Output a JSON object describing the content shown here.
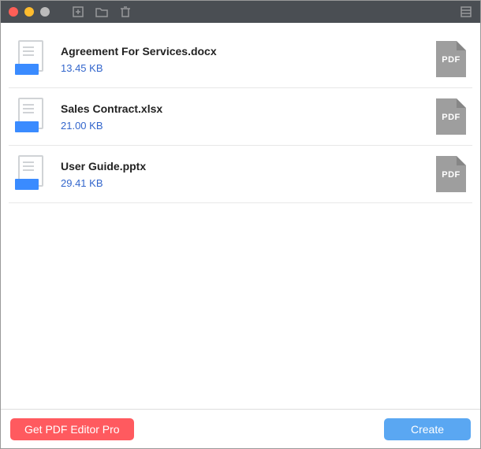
{
  "titlebar": {
    "icons": {
      "add": "add-file-icon",
      "folder": "folder-icon",
      "trash": "trash-icon",
      "list": "list-icon"
    }
  },
  "files": [
    {
      "name": "Agreement For Services.docx",
      "size": "13.45 KB",
      "target_label": "PDF"
    },
    {
      "name": "Sales Contract.xlsx",
      "size": "21.00 KB",
      "target_label": "PDF"
    },
    {
      "name": "User Guide.pptx",
      "size": "29.41 KB",
      "target_label": "PDF"
    }
  ],
  "footer": {
    "pro_label": "Get PDF Editor Pro",
    "create_label": "Create"
  }
}
